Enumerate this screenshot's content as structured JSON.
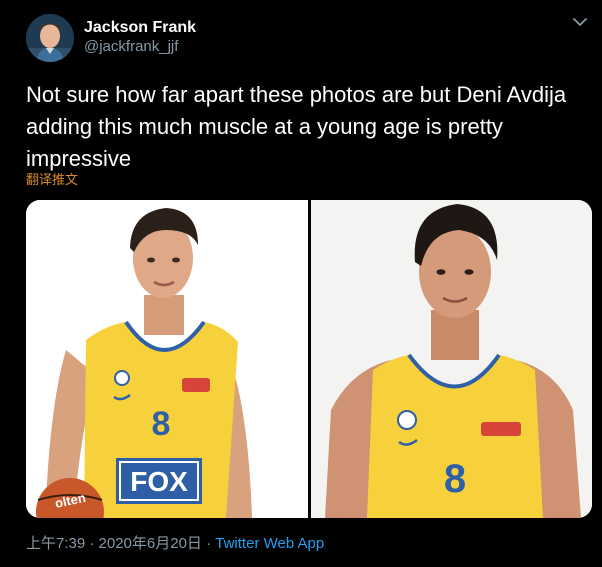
{
  "author": {
    "name": "Jackson Frank",
    "handle": "@jackfrank_jjf"
  },
  "tweet": {
    "text": "Not sure how far apart these photos are but Deni Avdija adding this much muscle at a young age is pretty impressive",
    "translate_label": "翻译推文"
  },
  "media": {
    "left_photo": {
      "jersey_number": "8",
      "sponsor_text": "FOX",
      "ball_text": "olten"
    },
    "right_photo": {
      "jersey_number": "8"
    }
  },
  "meta": {
    "timestamp": "上午7:39 · 2020年6月20日",
    "separator": " · ",
    "source": "Twitter Web App"
  },
  "colors": {
    "background": "#000000",
    "text": "#ffffff",
    "muted": "#8899a6",
    "link": "#1da1f2",
    "translate": "#d98a2b",
    "jersey": "#f7d13b",
    "jersey_number": "#2f5fa6"
  },
  "icons": [
    "avatar",
    "caret-down-icon"
  ]
}
